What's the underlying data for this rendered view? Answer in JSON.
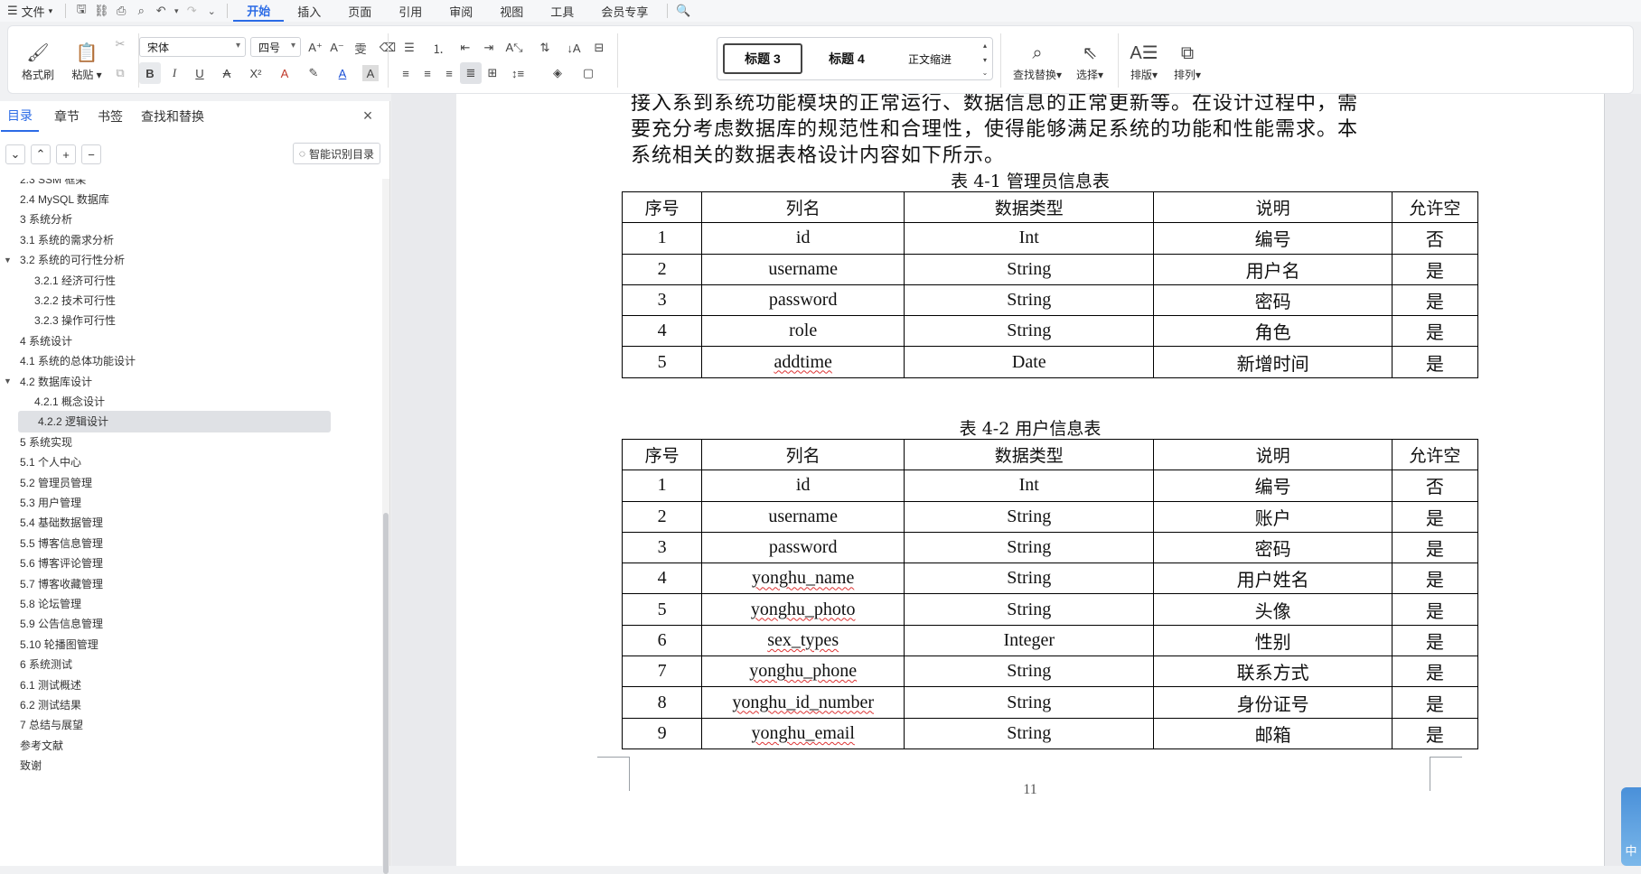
{
  "menubar": {
    "file_label": "文件",
    "tabs": [
      "开始",
      "插入",
      "页面",
      "引用",
      "审阅",
      "视图",
      "工具",
      "会员专享"
    ],
    "active_tab": "开始"
  },
  "ribbon": {
    "format_painter": "格式刷",
    "paste": "粘贴",
    "font_name": "宋体",
    "font_size": "四号",
    "styles": [
      "标题 3",
      "标题 4",
      "正文缩进"
    ],
    "find_replace": "查找替换",
    "select": "选择",
    "layout": "排版",
    "arrange": "排列"
  },
  "left_panel": {
    "tabs": [
      "目录",
      "章节",
      "书签",
      "查找和替换"
    ],
    "active_tab": "目录",
    "smart_toc_button": "智能识别目录",
    "toc_items": [
      {
        "label": "2.3 SSM 框架",
        "level": 2
      },
      {
        "label": "2.4 MySQL 数据库",
        "level": 2
      },
      {
        "label": "3 系统分析",
        "level": 1
      },
      {
        "label": "3.1 系统的需求分析",
        "level": 2
      },
      {
        "label": "3.2 系统的可行性分析",
        "level": 2,
        "expanded": true
      },
      {
        "label": "3.2.1 经济可行性",
        "level": 3
      },
      {
        "label": "3.2.2 技术可行性",
        "level": 3
      },
      {
        "label": "3.2.3 操作可行性",
        "level": 3
      },
      {
        "label": "4 系统设计",
        "level": 1
      },
      {
        "label": "4.1 系统的总体功能设计",
        "level": 2
      },
      {
        "label": "4.2 数据库设计",
        "level": 2,
        "expanded": true
      },
      {
        "label": "4.2.1 概念设计",
        "level": 3
      },
      {
        "label": "4.2.2 逻辑设计",
        "level": 3,
        "selected": true
      },
      {
        "label": "5 系统实现",
        "level": 1
      },
      {
        "label": "5.1 个人中心",
        "level": 2
      },
      {
        "label": "5.2 管理员管理",
        "level": 2
      },
      {
        "label": "5.3 用户管理",
        "level": 2
      },
      {
        "label": "5.4 基础数据管理",
        "level": 2
      },
      {
        "label": "5.5 博客信息管理",
        "level": 2
      },
      {
        "label": "5.6 博客评论管理",
        "level": 2
      },
      {
        "label": "5.7 博客收藏管理",
        "level": 2
      },
      {
        "label": "5.8 论坛管理",
        "level": 2
      },
      {
        "label": "5.9 公告信息管理",
        "level": 2
      },
      {
        "label": "5.10 轮播图管理",
        "level": 2
      },
      {
        "label": "6 系统测试",
        "level": 1
      },
      {
        "label": "6.1 测试概述",
        "level": 2
      },
      {
        "label": "6.2 测试结果",
        "level": 2
      },
      {
        "label": "7 总结与展望",
        "level": 1
      },
      {
        "label": "参考文献",
        "level": 1
      },
      {
        "label": "致谢",
        "level": 1
      }
    ]
  },
  "document": {
    "para_lines": [
      "接入系到系统功能模块的正常运行、数据信息的正常更新等。在设计过程中，需",
      "要充分考虑数据库的规范性和合理性，使得能够满足系统的功能和性能需求。本",
      "系统相关的数据表格设计内容如下所示。"
    ],
    "table1": {
      "caption": "表 4-1 管理员信息表",
      "headers": [
        "序号",
        "列名",
        "数据类型",
        "说明",
        "允许空"
      ],
      "rows": [
        [
          "1",
          "id",
          "Int",
          "编号",
          "否"
        ],
        [
          "2",
          "username",
          "String",
          "用户名",
          "是"
        ],
        [
          "3",
          "password",
          "String",
          "密码",
          "是"
        ],
        [
          "4",
          "role",
          "String",
          "角色",
          "是"
        ],
        [
          "5",
          "addtime",
          "Date",
          "新增时间",
          "是"
        ]
      ]
    },
    "table2": {
      "caption": "表 4-2 用户信息表",
      "headers": [
        "序号",
        "列名",
        "数据类型",
        "说明",
        "允许空"
      ],
      "rows": [
        [
          "1",
          "id",
          "Int",
          "编号",
          "否"
        ],
        [
          "2",
          "username",
          "String",
          "账户",
          "是"
        ],
        [
          "3",
          "password",
          "String",
          "密码",
          "是"
        ],
        [
          "4",
          "yonghu_name",
          "String",
          "用户姓名",
          "是"
        ],
        [
          "5",
          "yonghu_photo",
          "String",
          "头像",
          "是"
        ],
        [
          "6",
          "sex_types",
          "Integer",
          "性别",
          "是"
        ],
        [
          "7",
          "yonghu_phone",
          "String",
          "联系方式",
          "是"
        ],
        [
          "8",
          "yonghu_id_number",
          "String",
          "身份证号",
          "是"
        ],
        [
          "9",
          "yonghu_email",
          "String",
          "邮箱",
          "是"
        ]
      ]
    },
    "page_number": "11"
  },
  "widget": {
    "label": "中"
  }
}
